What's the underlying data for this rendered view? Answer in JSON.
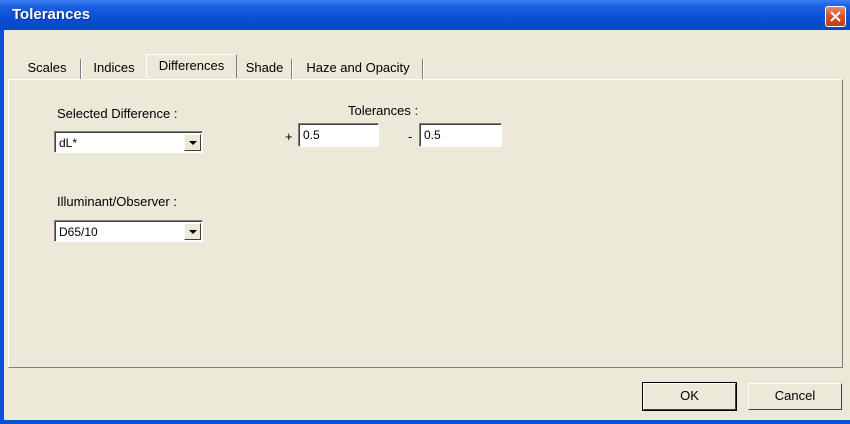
{
  "window": {
    "title": "Tolerances"
  },
  "tabs": [
    {
      "label": "Scales"
    },
    {
      "label": "Indices"
    },
    {
      "label": "Differences"
    },
    {
      "label": "Shade"
    },
    {
      "label": "Haze and Opacity"
    }
  ],
  "active_tab": "Differences",
  "selected_difference": {
    "label": "Selected Difference :",
    "value": "dL*"
  },
  "illuminant_observer": {
    "label": "Illuminant/Observer :",
    "value": "D65/10"
  },
  "tolerances": {
    "label": "Tolerances :",
    "plus_sign": "+",
    "plus_value": "0.5",
    "minus_sign": "-",
    "minus_value": "0.5"
  },
  "buttons": {
    "ok_label": "OK",
    "cancel_label": "Cancel"
  },
  "colors": {
    "titlebar": "#0a4fd6",
    "dialog_bg": "#ece9d8",
    "close_button": "#d5502c"
  },
  "icons": {
    "close": "close-icon",
    "dropdown": "chevron-down-icon"
  }
}
